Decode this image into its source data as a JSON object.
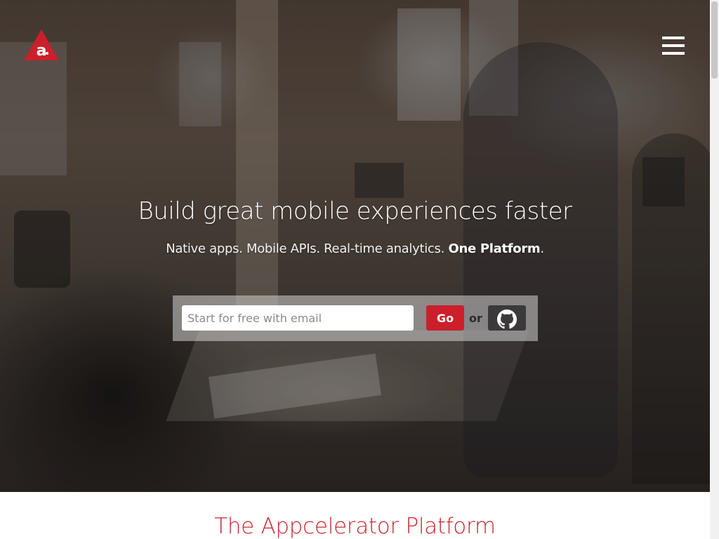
{
  "header": {
    "logo_letter": "a",
    "logo_icon": "appcelerator-logo-icon",
    "menu_icon": "hamburger-menu-icon"
  },
  "hero": {
    "headline": "Build great mobile experiences faster",
    "subhead_prefix": "Native apps. Mobile APIs. Real-time analytics. ",
    "subhead_bold": "One Platform",
    "subhead_suffix": "."
  },
  "signup": {
    "email_placeholder": "Start for free with email",
    "email_value": "",
    "go_label": "Go",
    "or_label": "or",
    "github_icon": "github-icon"
  },
  "platform": {
    "title": "The Appcelerator Platform"
  },
  "colors": {
    "brand_red": "#cc1f2b",
    "title_red": "#c9262f",
    "github_button": "#3a3a3a"
  }
}
